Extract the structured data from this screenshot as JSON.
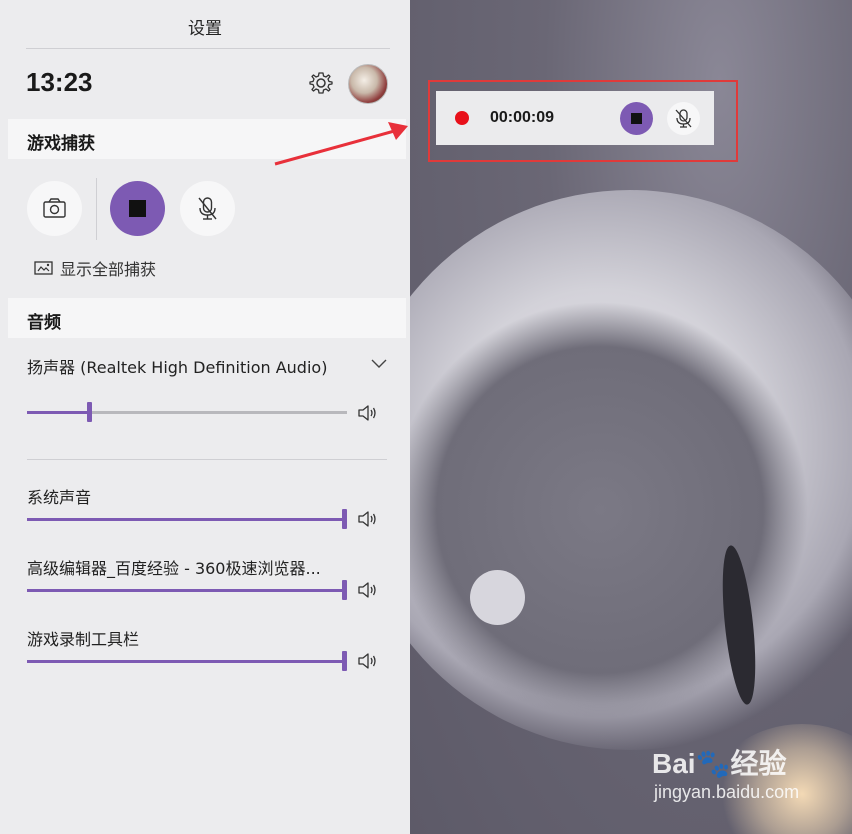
{
  "panel": {
    "title": "设置",
    "clock": "13:23",
    "capture_section": {
      "title": "游戏捕获",
      "show_all_label": "显示全部捕获"
    },
    "audio_section": {
      "title": "音频",
      "device_label": "扬声器 (Realtek High Definition Audio)",
      "device_volume": 0.19,
      "apps": [
        {
          "label": "系统声音",
          "volume": 1.0
        },
        {
          "label": "高级编辑器_百度经验 - 360极速浏览器...",
          "volume": 1.0
        },
        {
          "label": "游戏录制工具栏",
          "volume": 1.0
        }
      ]
    }
  },
  "capture_widget": {
    "elapsed": "00:00:09",
    "recording_indicator_color": "#e8101a"
  },
  "watermark": {
    "brand": "Bai",
    "brand_suffix": "经验",
    "url": "jingyan.baidu.com"
  },
  "icons": [
    "settings-gear-icon",
    "camera-icon",
    "stop-icon",
    "mic-muted-icon",
    "show-captures-icon",
    "chevron-down-icon",
    "speaker-icon",
    "red-arrow"
  ],
  "colors": {
    "accent": "#7d5ab3",
    "highlight_box": "#e03a3a",
    "panel_bg": "#ececee"
  }
}
